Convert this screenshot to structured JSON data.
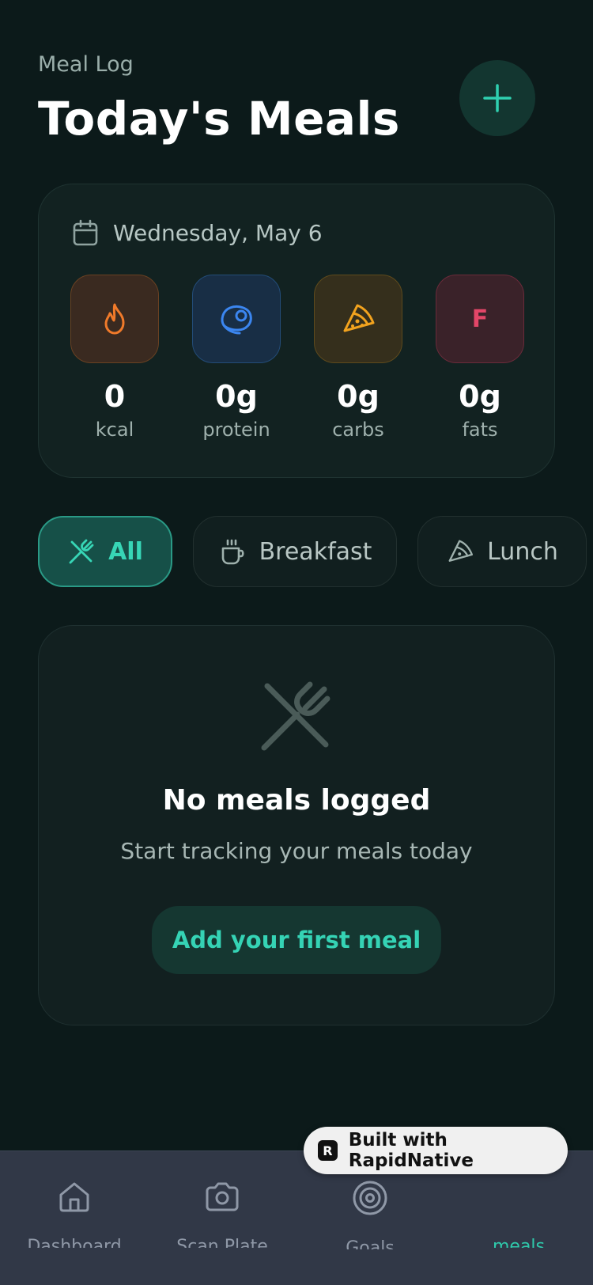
{
  "header": {
    "eyebrow": "Meal Log",
    "title": "Today's Meals",
    "add_icon": "plus-icon"
  },
  "summary": {
    "date": "Wednesday, May 6",
    "macros": [
      {
        "value": "0",
        "label": "kcal",
        "icon": "flame-icon",
        "color": "#f07a2a"
      },
      {
        "value": "0g",
        "label": "protein",
        "icon": "steak-icon",
        "color": "#3b86f0"
      },
      {
        "value": "0g",
        "label": "carbs",
        "icon": "pizza-icon",
        "color": "#f2a31e"
      },
      {
        "value": "0g",
        "label": "fats",
        "icon_text": "F",
        "color": "#e24668"
      }
    ]
  },
  "filters": [
    {
      "label": "All",
      "icon": "utensils-crossed-icon",
      "active": true
    },
    {
      "label": "Breakfast",
      "icon": "coffee-icon",
      "active": false
    },
    {
      "label": "Lunch",
      "icon": "pizza-icon",
      "active": false
    }
  ],
  "empty_state": {
    "icon": "utensils-crossed-icon",
    "title": "No meals logged",
    "subtitle": "Start tracking your meals today",
    "button_label": "Add your first meal"
  },
  "nav": [
    {
      "label": "Dashboard",
      "icon": "home-icon",
      "active": false
    },
    {
      "label": "Scan Plate",
      "icon": "camera-icon",
      "active": false
    },
    {
      "label": "Goals",
      "icon": "target-icon",
      "active": false
    },
    {
      "label": "meals",
      "icon": "",
      "active": true
    }
  ],
  "badge": {
    "text": "Built with RapidNative",
    "logo_letter": "R"
  },
  "colors": {
    "accent": "#2fc9ab",
    "background": "#0c1a1a",
    "card": "#122221",
    "nav": "#313847"
  }
}
